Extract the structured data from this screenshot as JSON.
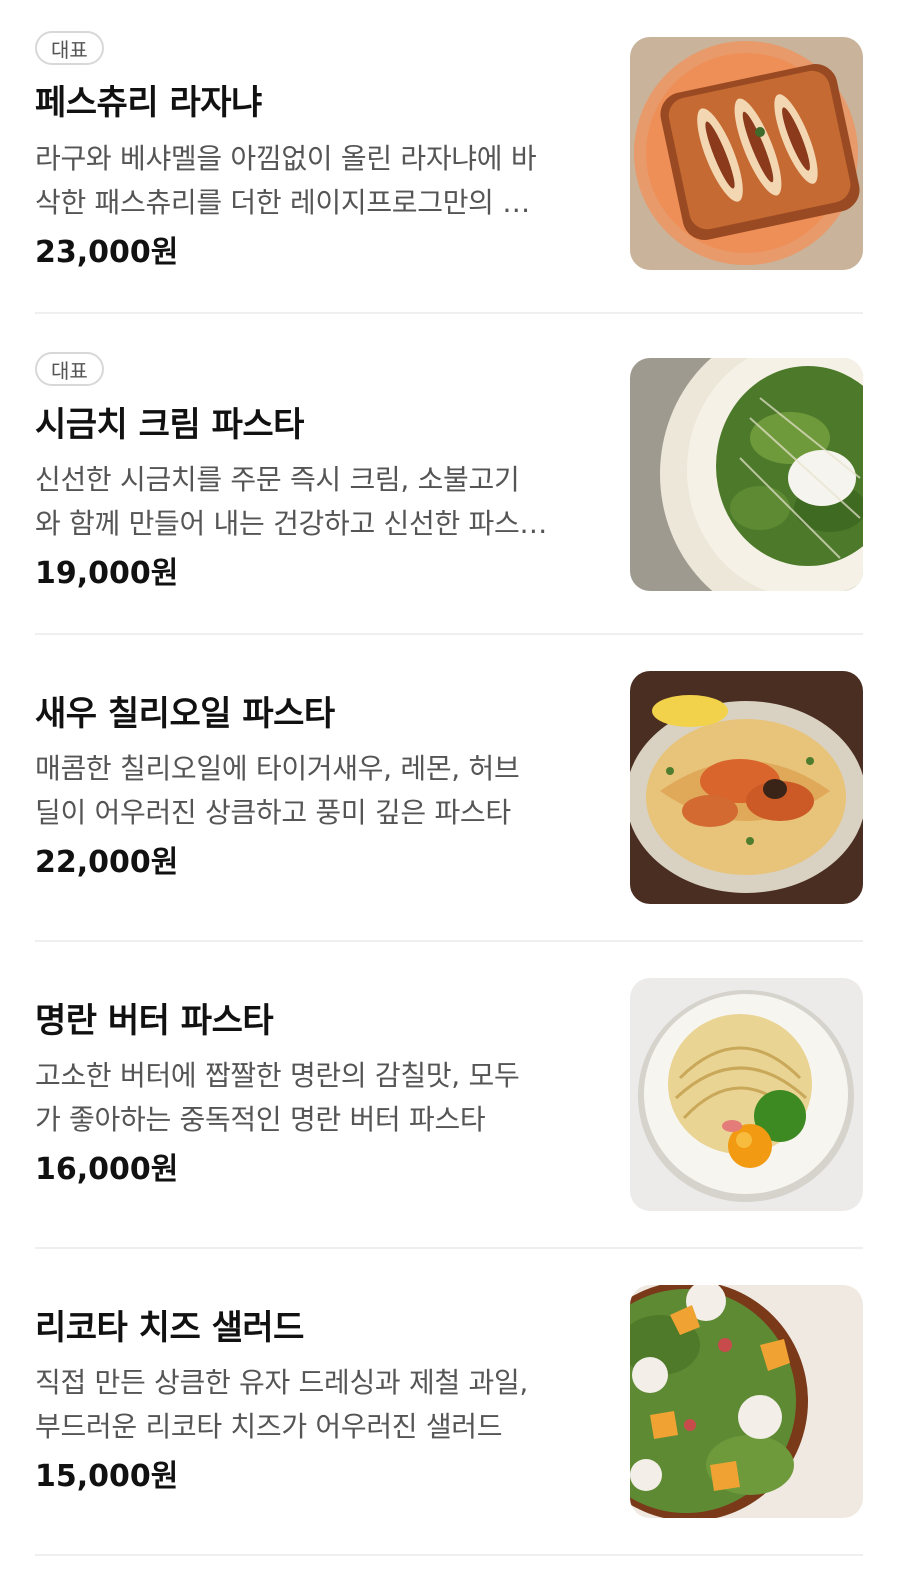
{
  "menu": {
    "items": [
      {
        "badge": "대표",
        "name": "페스츄리 라자냐",
        "desc_line1": "라구와 베샤멜을 아낌없이 올린 라자냐에 바",
        "desc_line2": "삭한 패스츄리를 더한 레이지프로그만의 …",
        "price": "23,000원",
        "image_icon": "lasagna-photo"
      },
      {
        "badge": "대표",
        "name": "시금치 크림 파스타",
        "desc_line1": "신선한 시금치를 주문 즉시 크림, 소불고기",
        "desc_line2": "와 함께 만들어 내는 건강하고 신선한 파스…",
        "price": "19,000원",
        "image_icon": "spinach-pasta-photo"
      },
      {
        "name": "새우 칠리오일 파스타",
        "desc_line1": "매콤한 칠리오일에 타이거새우, 레몬, 허브",
        "desc_line2": "딜이 어우러진 상큼하고 풍미 깊은 파스타",
        "price": "22,000원",
        "image_icon": "shrimp-pasta-photo"
      },
      {
        "name": "명란 버터 파스타",
        "desc_line1": "고소한 버터에 짭짤한 명란의 감칠맛, 모두",
        "desc_line2": "가 좋아하는 중독적인 명란 버터 파스타",
        "price": "16,000원",
        "image_icon": "mentaiko-pasta-photo"
      },
      {
        "name": "리코타 치즈 샐러드",
        "desc_line1": "직접 만든 상큼한 유자 드레싱과 제철 과일,",
        "desc_line2": "부드러운 리코타 치즈가 어우러진 샐러드",
        "price": "15,000원",
        "image_icon": "ricotta-salad-photo"
      }
    ]
  }
}
